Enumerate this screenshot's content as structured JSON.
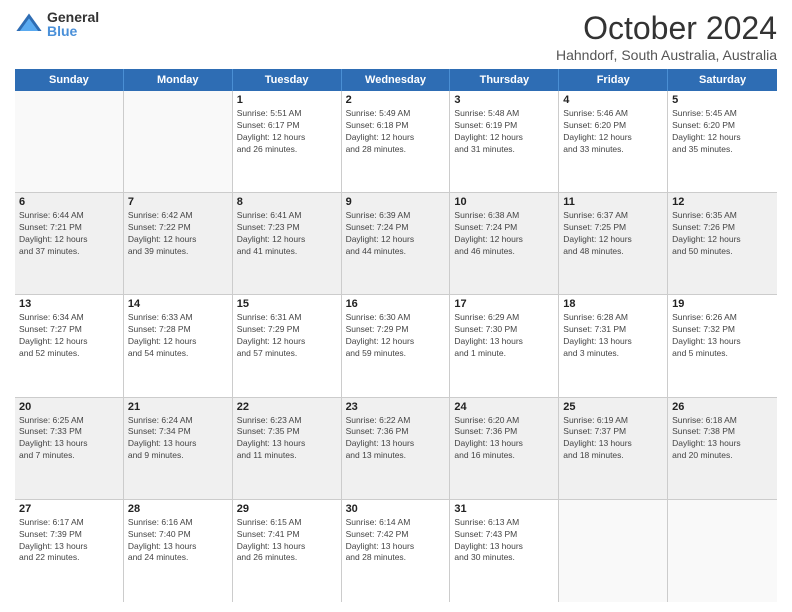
{
  "header": {
    "logo_general": "General",
    "logo_blue": "Blue",
    "month_title": "October 2024",
    "location": "Hahndorf, South Australia, Australia"
  },
  "days_of_week": [
    "Sunday",
    "Monday",
    "Tuesday",
    "Wednesday",
    "Thursday",
    "Friday",
    "Saturday"
  ],
  "weeks": [
    [
      {
        "day": "",
        "info": "",
        "empty": true
      },
      {
        "day": "",
        "info": "",
        "empty": true
      },
      {
        "day": "1",
        "info": "Sunrise: 5:51 AM\nSunset: 6:17 PM\nDaylight: 12 hours\nand 26 minutes.",
        "empty": false
      },
      {
        "day": "2",
        "info": "Sunrise: 5:49 AM\nSunset: 6:18 PM\nDaylight: 12 hours\nand 28 minutes.",
        "empty": false
      },
      {
        "day": "3",
        "info": "Sunrise: 5:48 AM\nSunset: 6:19 PM\nDaylight: 12 hours\nand 31 minutes.",
        "empty": false
      },
      {
        "day": "4",
        "info": "Sunrise: 5:46 AM\nSunset: 6:20 PM\nDaylight: 12 hours\nand 33 minutes.",
        "empty": false
      },
      {
        "day": "5",
        "info": "Sunrise: 5:45 AM\nSunset: 6:20 PM\nDaylight: 12 hours\nand 35 minutes.",
        "empty": false
      }
    ],
    [
      {
        "day": "6",
        "info": "Sunrise: 6:44 AM\nSunset: 7:21 PM\nDaylight: 12 hours\nand 37 minutes.",
        "empty": false
      },
      {
        "day": "7",
        "info": "Sunrise: 6:42 AM\nSunset: 7:22 PM\nDaylight: 12 hours\nand 39 minutes.",
        "empty": false
      },
      {
        "day": "8",
        "info": "Sunrise: 6:41 AM\nSunset: 7:23 PM\nDaylight: 12 hours\nand 41 minutes.",
        "empty": false
      },
      {
        "day": "9",
        "info": "Sunrise: 6:39 AM\nSunset: 7:24 PM\nDaylight: 12 hours\nand 44 minutes.",
        "empty": false
      },
      {
        "day": "10",
        "info": "Sunrise: 6:38 AM\nSunset: 7:24 PM\nDaylight: 12 hours\nand 46 minutes.",
        "empty": false
      },
      {
        "day": "11",
        "info": "Sunrise: 6:37 AM\nSunset: 7:25 PM\nDaylight: 12 hours\nand 48 minutes.",
        "empty": false
      },
      {
        "day": "12",
        "info": "Sunrise: 6:35 AM\nSunset: 7:26 PM\nDaylight: 12 hours\nand 50 minutes.",
        "empty": false
      }
    ],
    [
      {
        "day": "13",
        "info": "Sunrise: 6:34 AM\nSunset: 7:27 PM\nDaylight: 12 hours\nand 52 minutes.",
        "empty": false
      },
      {
        "day": "14",
        "info": "Sunrise: 6:33 AM\nSunset: 7:28 PM\nDaylight: 12 hours\nand 54 minutes.",
        "empty": false
      },
      {
        "day": "15",
        "info": "Sunrise: 6:31 AM\nSunset: 7:29 PM\nDaylight: 12 hours\nand 57 minutes.",
        "empty": false
      },
      {
        "day": "16",
        "info": "Sunrise: 6:30 AM\nSunset: 7:29 PM\nDaylight: 12 hours\nand 59 minutes.",
        "empty": false
      },
      {
        "day": "17",
        "info": "Sunrise: 6:29 AM\nSunset: 7:30 PM\nDaylight: 13 hours\nand 1 minute.",
        "empty": false
      },
      {
        "day": "18",
        "info": "Sunrise: 6:28 AM\nSunset: 7:31 PM\nDaylight: 13 hours\nand 3 minutes.",
        "empty": false
      },
      {
        "day": "19",
        "info": "Sunrise: 6:26 AM\nSunset: 7:32 PM\nDaylight: 13 hours\nand 5 minutes.",
        "empty": false
      }
    ],
    [
      {
        "day": "20",
        "info": "Sunrise: 6:25 AM\nSunset: 7:33 PM\nDaylight: 13 hours\nand 7 minutes.",
        "empty": false
      },
      {
        "day": "21",
        "info": "Sunrise: 6:24 AM\nSunset: 7:34 PM\nDaylight: 13 hours\nand 9 minutes.",
        "empty": false
      },
      {
        "day": "22",
        "info": "Sunrise: 6:23 AM\nSunset: 7:35 PM\nDaylight: 13 hours\nand 11 minutes.",
        "empty": false
      },
      {
        "day": "23",
        "info": "Sunrise: 6:22 AM\nSunset: 7:36 PM\nDaylight: 13 hours\nand 13 minutes.",
        "empty": false
      },
      {
        "day": "24",
        "info": "Sunrise: 6:20 AM\nSunset: 7:36 PM\nDaylight: 13 hours\nand 16 minutes.",
        "empty": false
      },
      {
        "day": "25",
        "info": "Sunrise: 6:19 AM\nSunset: 7:37 PM\nDaylight: 13 hours\nand 18 minutes.",
        "empty": false
      },
      {
        "day": "26",
        "info": "Sunrise: 6:18 AM\nSunset: 7:38 PM\nDaylight: 13 hours\nand 20 minutes.",
        "empty": false
      }
    ],
    [
      {
        "day": "27",
        "info": "Sunrise: 6:17 AM\nSunset: 7:39 PM\nDaylight: 13 hours\nand 22 minutes.",
        "empty": false
      },
      {
        "day": "28",
        "info": "Sunrise: 6:16 AM\nSunset: 7:40 PM\nDaylight: 13 hours\nand 24 minutes.",
        "empty": false
      },
      {
        "day": "29",
        "info": "Sunrise: 6:15 AM\nSunset: 7:41 PM\nDaylight: 13 hours\nand 26 minutes.",
        "empty": false
      },
      {
        "day": "30",
        "info": "Sunrise: 6:14 AM\nSunset: 7:42 PM\nDaylight: 13 hours\nand 28 minutes.",
        "empty": false
      },
      {
        "day": "31",
        "info": "Sunrise: 6:13 AM\nSunset: 7:43 PM\nDaylight: 13 hours\nand 30 minutes.",
        "empty": false
      },
      {
        "day": "",
        "info": "",
        "empty": true
      },
      {
        "day": "",
        "info": "",
        "empty": true
      }
    ]
  ]
}
